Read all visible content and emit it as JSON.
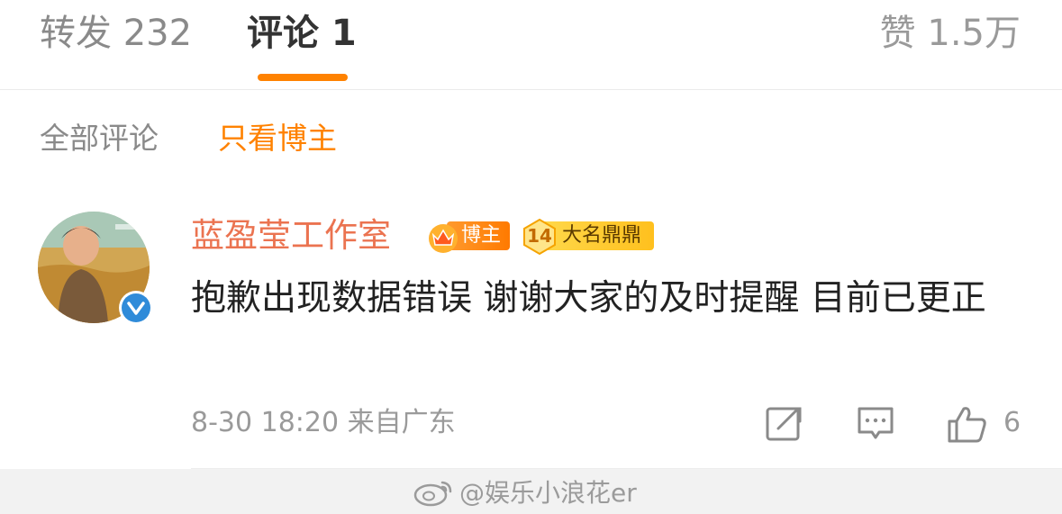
{
  "tabs": {
    "repost_label": "转发 232",
    "comments_label": "评论 1",
    "likes_label": "赞 1.5万"
  },
  "filters": {
    "all_label": "全部评论",
    "blogger_only_label": "只看博主"
  },
  "comment": {
    "author": "蓝盈莹工作室",
    "badges": {
      "blogger": "博主",
      "fame_level": "14",
      "fame_label": "大名鼎鼎"
    },
    "text": "抱歉出现数据错误 谢谢大家的及时提醒 目前已更正",
    "meta": "8-30 18:20 来自广东",
    "like_count": "6"
  },
  "watermark": {
    "text": "@娱乐小浪花er"
  },
  "colors": {
    "accent": "#ff8200",
    "author": "#eb7350",
    "verified": "#2f8bd9"
  },
  "icons": [
    "crown-icon",
    "verified-icon",
    "share-icon",
    "comment-icon",
    "thumb-up-icon",
    "weibo-logo-icon"
  ]
}
